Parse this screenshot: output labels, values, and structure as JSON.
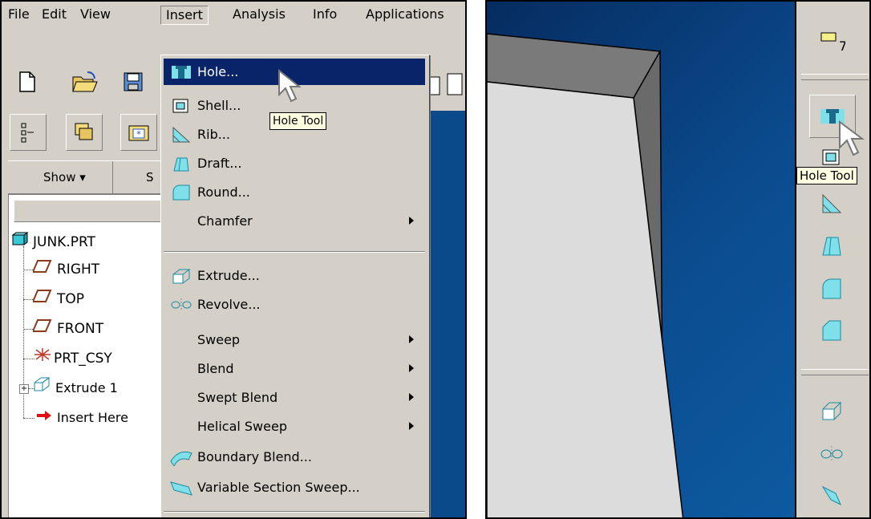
{
  "menubar": {
    "items": [
      {
        "label": "File"
      },
      {
        "label": "Edit"
      },
      {
        "label": "View"
      },
      {
        "label": "Insert"
      },
      {
        "label": "Analysis"
      },
      {
        "label": "Info"
      },
      {
        "label": "Applications"
      }
    ]
  },
  "navigator": {
    "show_label": "Show ▾",
    "show_cut_label": "S",
    "tree": [
      {
        "label": "JUNK.PRT"
      },
      {
        "label": "RIGHT"
      },
      {
        "label": "TOP"
      },
      {
        "label": "FRONT"
      },
      {
        "label": "PRT_CSY"
      },
      {
        "label": "Extrude 1"
      },
      {
        "label": "Insert Here"
      }
    ]
  },
  "insert_menu": {
    "items": [
      {
        "label": "Hole...",
        "icon": "hole-icon"
      },
      {
        "label": "Shell...",
        "icon": "shell-icon"
      },
      {
        "label": "Rib...",
        "icon": "rib-icon"
      },
      {
        "label": "Draft...",
        "icon": "draft-icon"
      },
      {
        "label": "Round...",
        "icon": "round-icon"
      },
      {
        "label": "Chamfer",
        "submenu": true
      },
      {
        "label": "Extrude...",
        "icon": "extrude-icon"
      },
      {
        "label": "Revolve...",
        "icon": "revolve-icon"
      },
      {
        "label": "Sweep",
        "submenu": true
      },
      {
        "label": "Blend",
        "submenu": true
      },
      {
        "label": "Swept Blend",
        "submenu": true
      },
      {
        "label": "Helical Sweep",
        "submenu": true
      },
      {
        "label": "Boundary Blend...",
        "icon": "boundary-blend-icon"
      },
      {
        "label": "Variable Section Sweep...",
        "icon": "variable-section-sweep-icon"
      }
    ]
  },
  "tooltips": {
    "left": "Hole Tool",
    "right": "Hole Tool"
  },
  "colors": {
    "menu_highlight": "#0a246a",
    "viewport_bg": "#083e7a",
    "chrome": "#d4d0c8"
  }
}
